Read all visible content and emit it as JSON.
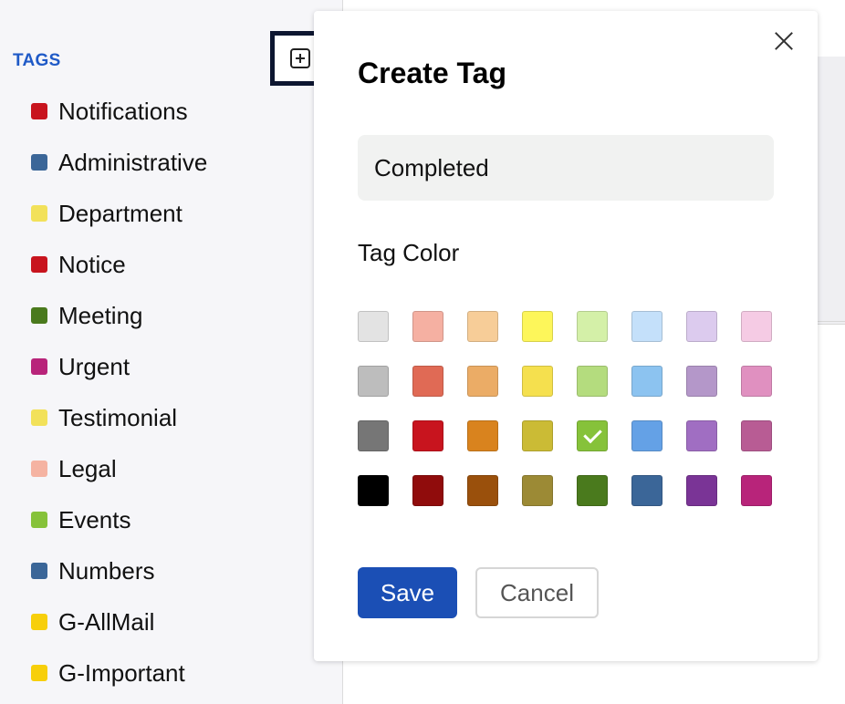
{
  "sidebar": {
    "title": "TAGS",
    "add_icon": "plus-square-icon",
    "tags": [
      {
        "label": "Notifications",
        "color": "#c8141e"
      },
      {
        "label": "Administrative",
        "color": "#3b6698"
      },
      {
        "label": "Department",
        "color": "#f2e15a"
      },
      {
        "label": "Notice",
        "color": "#c8141e"
      },
      {
        "label": "Meeting",
        "color": "#4a7a1d"
      },
      {
        "label": "Urgent",
        "color": "#b8247a"
      },
      {
        "label": "Testimonial",
        "color": "#f2e15a"
      },
      {
        "label": "Legal",
        "color": "#f5b3a2"
      },
      {
        "label": "Events",
        "color": "#86c23a"
      },
      {
        "label": "Numbers",
        "color": "#3b6698"
      },
      {
        "label": "G-AllMail",
        "color": "#f7cf0b"
      },
      {
        "label": "G-Important",
        "color": "#f7cf0b"
      }
    ]
  },
  "modal": {
    "title": "Create Tag",
    "close_icon": "close-icon",
    "name_value": "Completed",
    "color_label": "Tag Color",
    "palette": [
      [
        "#e3e3e3",
        "#f5b0a2",
        "#f7cd98",
        "#fdf65a",
        "#d4f0a8",
        "#c4e0fa",
        "#dccbee",
        "#f5cbe4"
      ],
      [
        "#bdbdbd",
        "#e06a55",
        "#ebac66",
        "#f5e04e",
        "#b4dc7e",
        "#8cc3f0",
        "#b497c9",
        "#e090c0"
      ],
      [
        "#767676",
        "#c8141e",
        "#d9831e",
        "#cbbb35",
        "#86c23a",
        "#64a1e6",
        "#a06ec2",
        "#b85c94"
      ],
      [
        "#000000",
        "#900c0c",
        "#9a500c",
        "#9c8a35",
        "#4a7a1d",
        "#3b6698",
        "#7a3496",
        "#b8247a"
      ]
    ],
    "selected_color": {
      "row": 2,
      "col": 4,
      "hex": "#86c23a"
    },
    "save_label": "Save",
    "cancel_label": "Cancel"
  },
  "colors": {
    "accent": "#1f5ac7",
    "save_button": "#1b4fb5"
  }
}
